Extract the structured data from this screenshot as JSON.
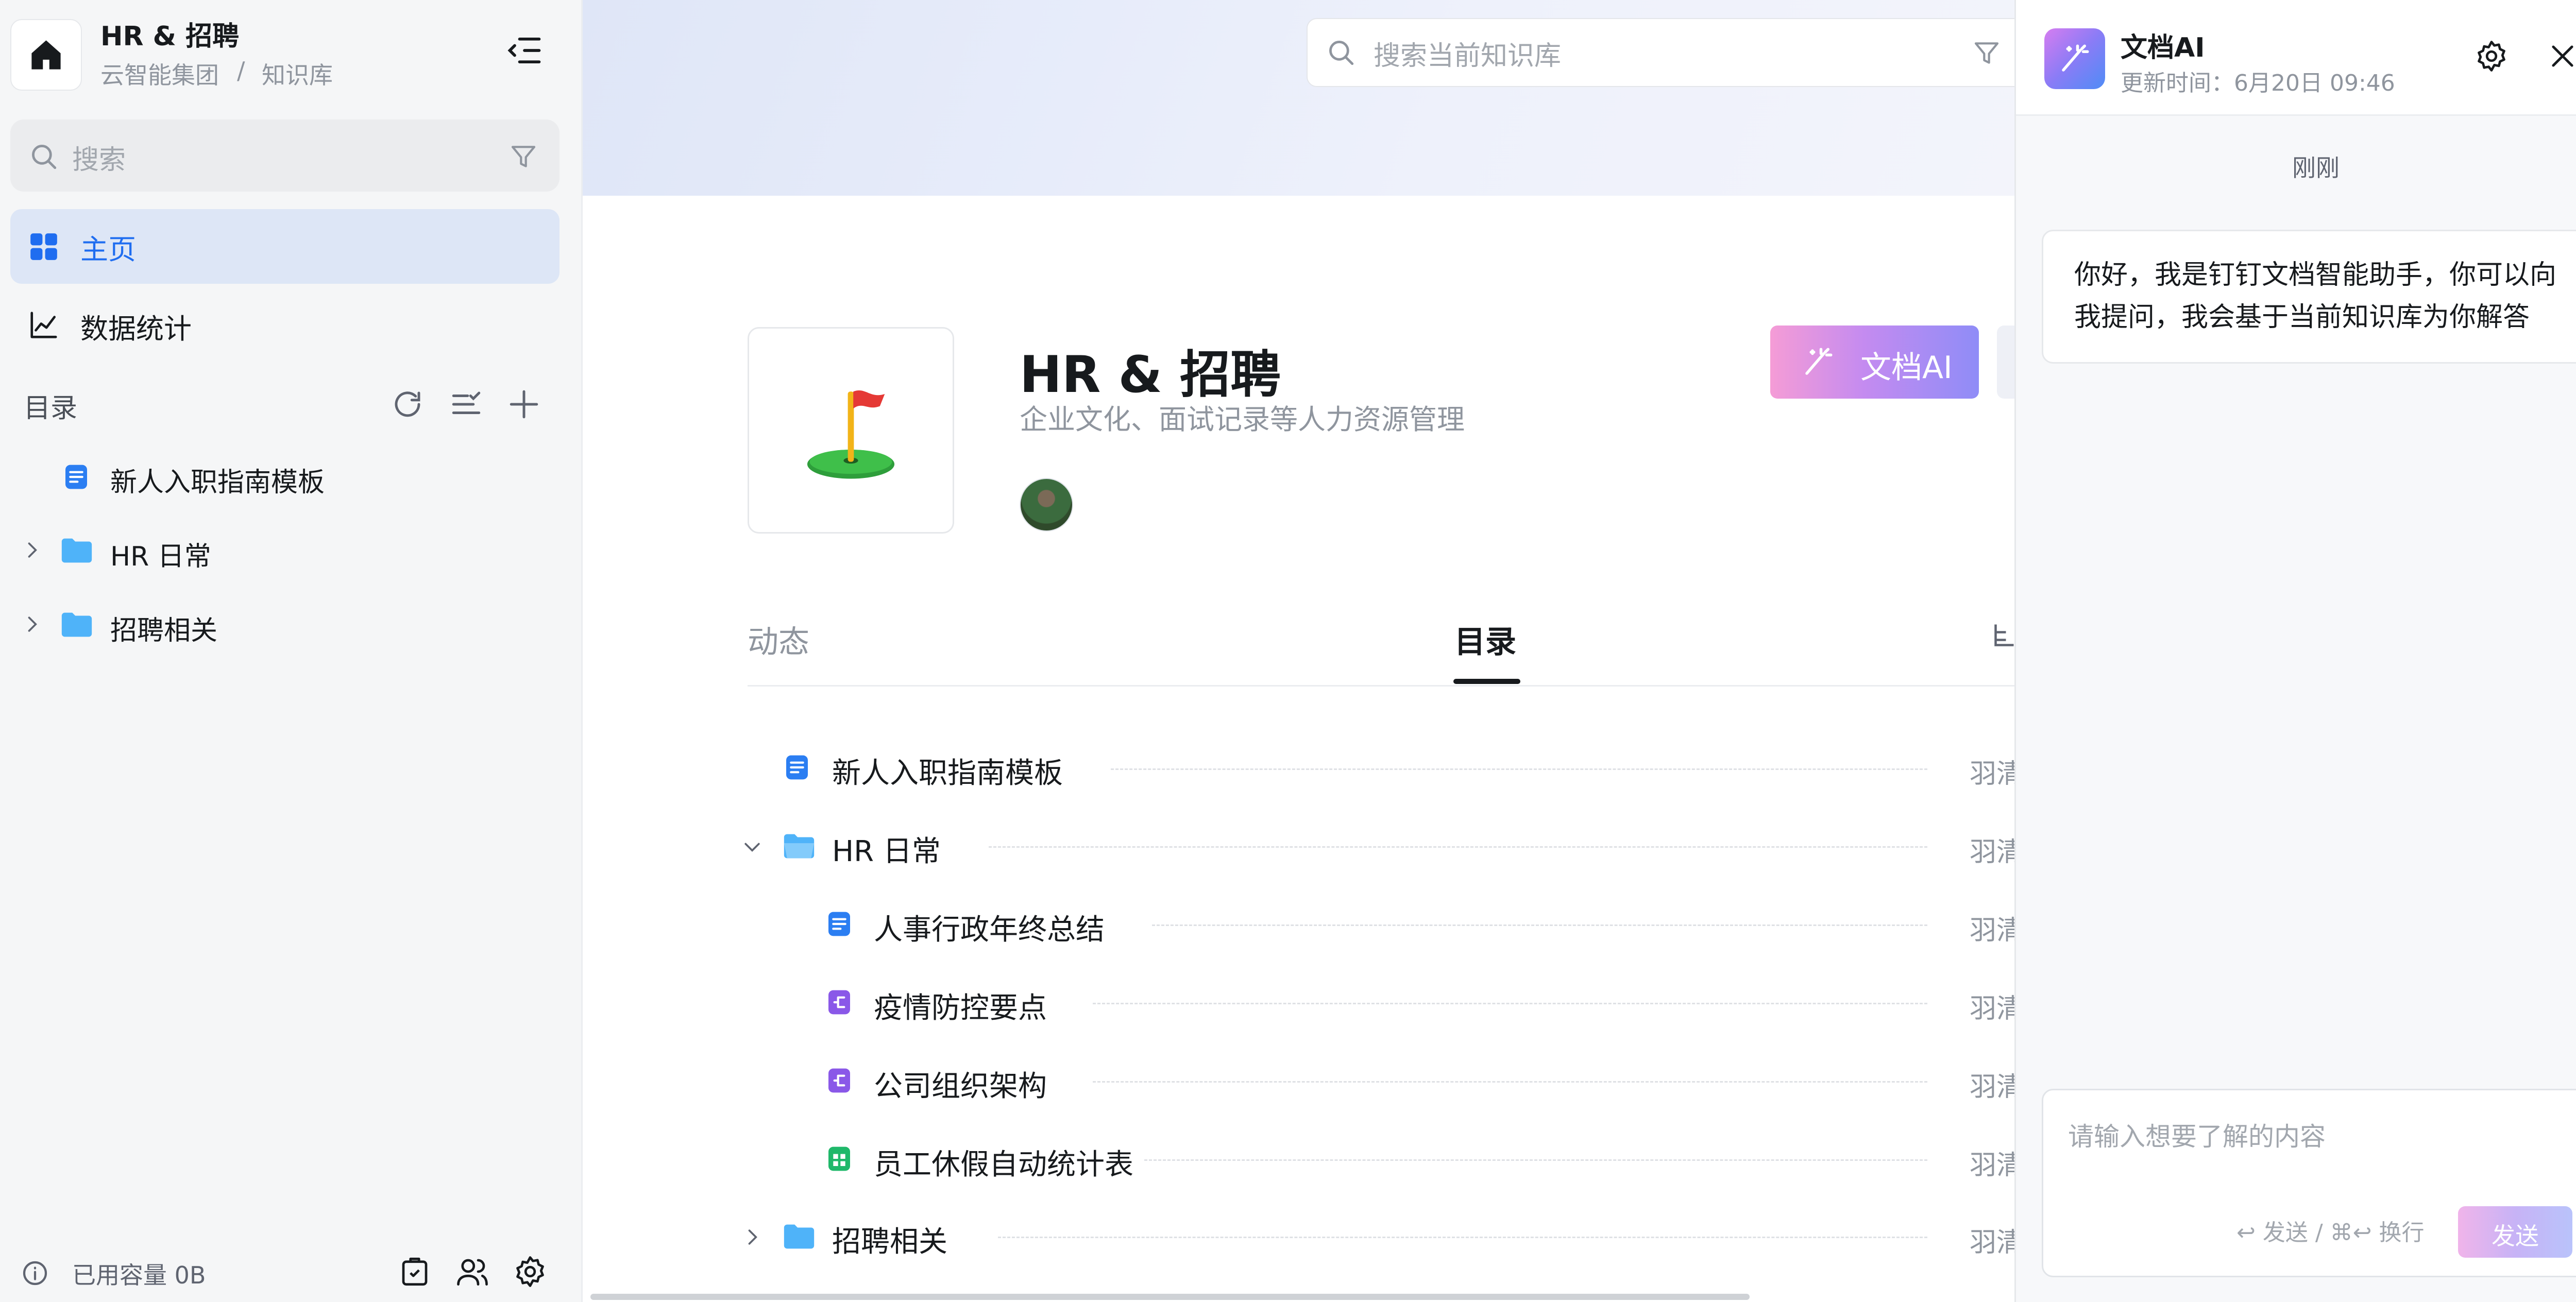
{
  "sidebar": {
    "kb_title": "HR & 招聘",
    "breadcrumb": [
      "云智能集团",
      "/",
      "知识库"
    ],
    "search_placeholder": "搜索",
    "nav": [
      {
        "label": "主页",
        "icon": "grid-icon",
        "active": true
      },
      {
        "label": "数据统计",
        "icon": "line-chart-icon",
        "active": false
      }
    ],
    "toc_label": "目录",
    "tree": [
      {
        "label": "新人入职指南模板",
        "type": "doc"
      },
      {
        "label": "HR 日常",
        "type": "folder"
      },
      {
        "label": "招聘相关",
        "type": "folder"
      }
    ],
    "storage_label": "已用容量 0B"
  },
  "main": {
    "search_placeholder": "搜索当前知识库",
    "title": "HR & 招聘",
    "subtitle": "企业文化、面试记录等人力资源管理",
    "icon": "golf-flag-icon",
    "ai_button_label": "文档AI",
    "tabs": [
      {
        "label": "动态",
        "active": false
      },
      {
        "label": "目录",
        "active": true
      }
    ],
    "rows": [
      {
        "label": "新人入职指南模板",
        "type": "doc",
        "owner": "羽清"
      },
      {
        "label": "HR 日常",
        "type": "folder",
        "expanded": true,
        "owner": "羽清"
      },
      {
        "label": "人事行政年终总结",
        "type": "doc",
        "owner": "羽清"
      },
      {
        "label": "疫情防控要点",
        "type": "mindmap",
        "owner": "羽清"
      },
      {
        "label": "公司组织架构",
        "type": "mindmap",
        "owner": "羽清"
      },
      {
        "label": "员工休假自动统计表",
        "type": "sheet",
        "owner": "羽清"
      },
      {
        "label": "招聘相关",
        "type": "folder",
        "expanded": false,
        "owner": "羽清"
      }
    ]
  },
  "ai_panel": {
    "title": "文档AI",
    "updated": "更新时间：6月20日 09:46",
    "time_label": "刚刚",
    "greeting": "你好，我是钉钉文档智能助手，你可以向我提问，我会基于当前知识库为你解答",
    "input_placeholder": "请输入想要了解的内容",
    "hint": "↩ 发送 / ⌘↩ 换行",
    "send_label": "发送"
  },
  "colors": {
    "accent": "#1f6df0",
    "doc_icon": "#2b7ef2",
    "folder_icon": "#4fb3f9",
    "mindmap_icon": "#8a58e8",
    "sheet_icon": "#1fb86a"
  }
}
